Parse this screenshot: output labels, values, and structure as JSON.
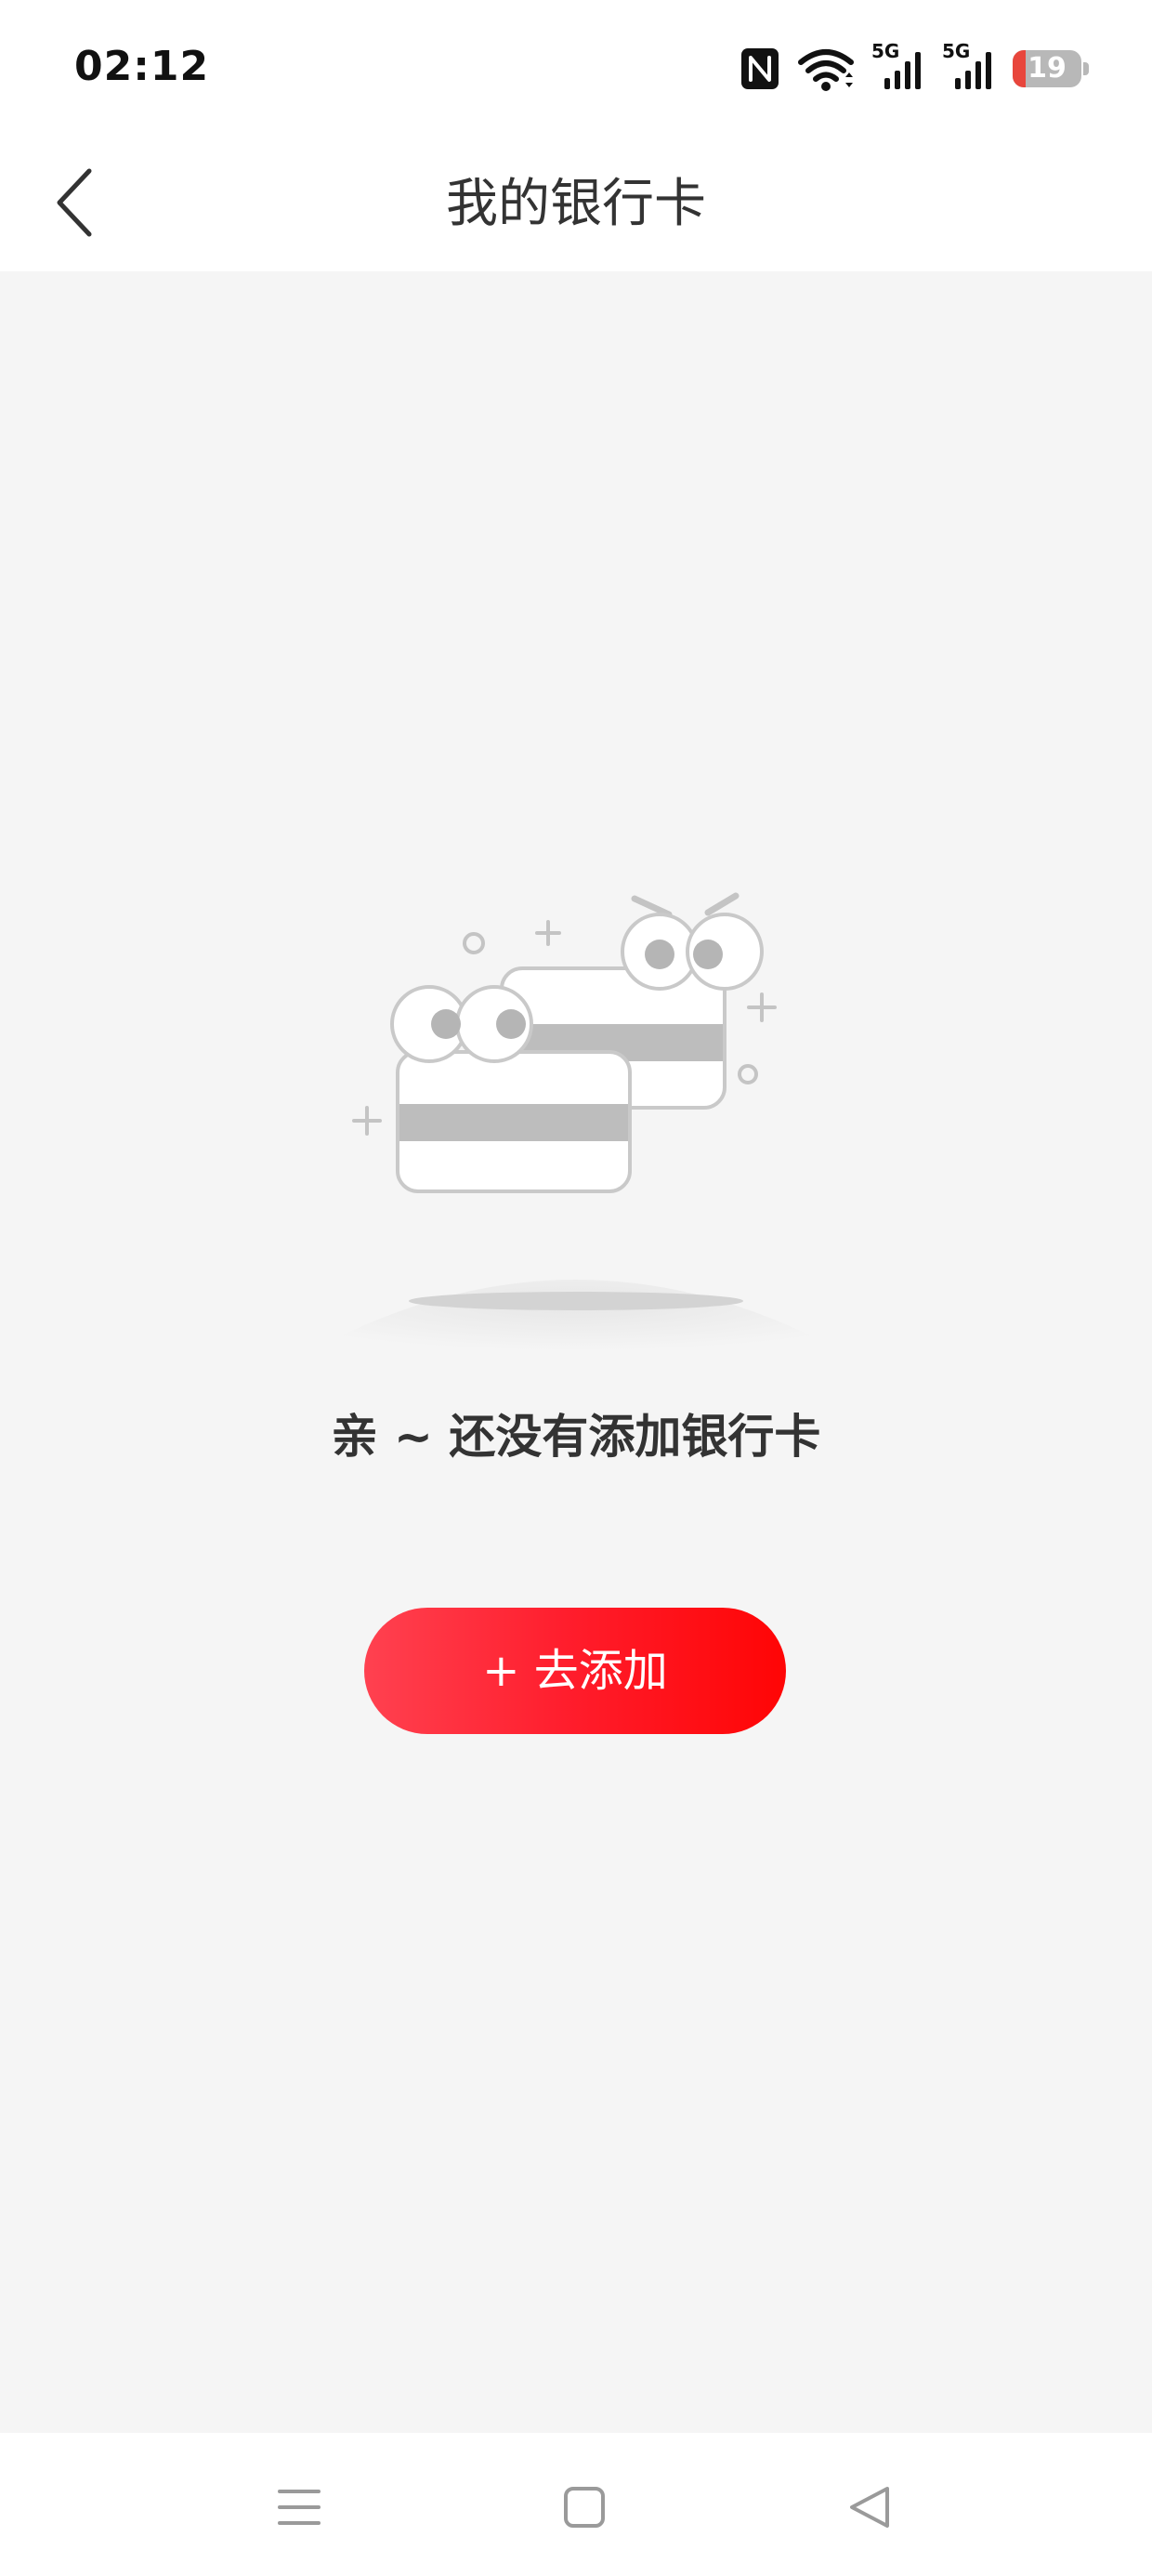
{
  "status_bar": {
    "time": "02:12",
    "network_1": "5G",
    "network_2": "5G",
    "battery_level": "19",
    "battery_fraction": 0.19,
    "battery_low_color": "#e8463c",
    "icons": [
      "nfc-icon",
      "wifi-icon",
      "signal-icon",
      "signal-icon",
      "battery-icon"
    ]
  },
  "header": {
    "title": "我的银行卡",
    "back_icon": "chevron-left-icon"
  },
  "empty_state": {
    "illustration": "bank-cards-with-eyes-illustration",
    "message": "亲 ~ 还没有添加银行卡",
    "add_button_label": "+ 去添加"
  },
  "nav_bar": {
    "icons": [
      "menu-icon",
      "home-square-icon",
      "back-triangle-icon"
    ]
  },
  "colors": {
    "accent_start": "#ff4150",
    "accent_end": "#ff0505",
    "background": "#f5f5f5",
    "surface": "#ffffff",
    "text_primary": "#333333"
  }
}
